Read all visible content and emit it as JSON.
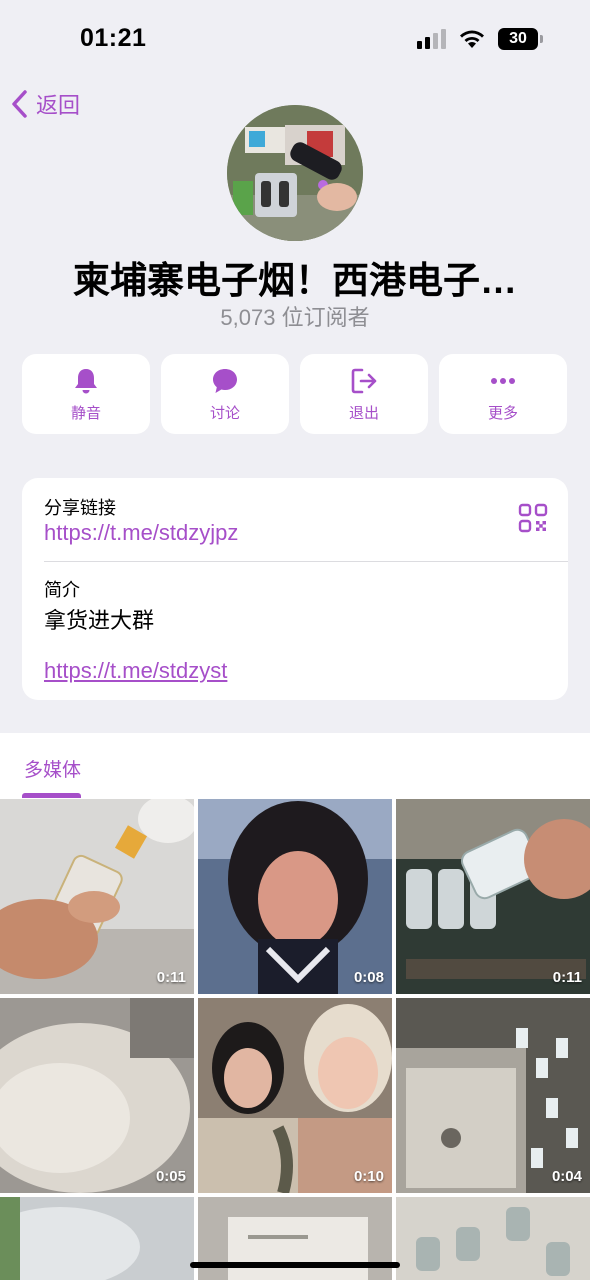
{
  "status_bar": {
    "time": "01:21",
    "battery": "30"
  },
  "nav": {
    "back_label": "返回"
  },
  "channel": {
    "title": "柬埔寨电子烟！西港电子…",
    "subscribers": "5,073 位订阅者"
  },
  "actions": [
    {
      "label": "静音",
      "icon": "bell-icon"
    },
    {
      "label": "讨论",
      "icon": "chat-bubble-icon"
    },
    {
      "label": "退出",
      "icon": "exit-icon"
    },
    {
      "label": "更多",
      "icon": "more-dots-icon"
    }
  ],
  "info": {
    "share_label": "分享链接",
    "share_link": "https://t.me/stdzyjpz",
    "about_label": "简介",
    "about_text": "拿货进大群",
    "about_link": "https://t.me/stdzyst"
  },
  "media": {
    "tab_label": "多媒体",
    "items": [
      {
        "duration": "0:11"
      },
      {
        "duration": "0:08"
      },
      {
        "duration": "0:11"
      },
      {
        "duration": "0:05"
      },
      {
        "duration": "0:10"
      },
      {
        "duration": "0:04"
      },
      {
        "duration": ""
      },
      {
        "duration": ""
      },
      {
        "duration": ""
      }
    ]
  },
  "colors": {
    "accent": "#a64fc9",
    "background": "#efeff4"
  }
}
